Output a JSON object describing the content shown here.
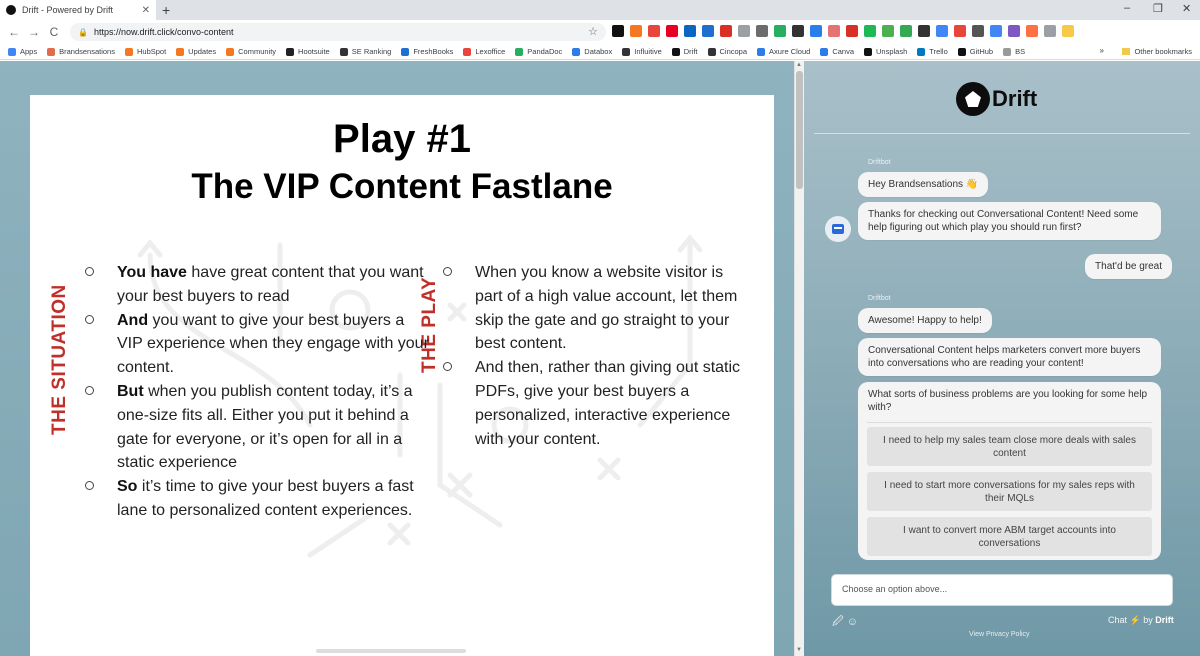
{
  "browser": {
    "tab_title": "Drift - Powered by Drift",
    "tab_close": "✕",
    "new_tab": "+",
    "url": "https://now.drift.click/convo-content",
    "win_min": "–",
    "win_max": "❐",
    "win_close": "✕",
    "back": "←",
    "forward": "→",
    "reload": "C",
    "star": "☆",
    "lock": "🔒"
  },
  "bookmarks": [
    {
      "label": "Apps",
      "color": "#4285f4"
    },
    {
      "label": "Brandsensations",
      "color": "#e06c4c"
    },
    {
      "label": "HubSpot",
      "color": "#f57722"
    },
    {
      "label": "Updates",
      "color": "#f57722"
    },
    {
      "label": "Community",
      "color": "#f57722"
    },
    {
      "label": "Hootsuite",
      "color": "#222"
    },
    {
      "label": "SE Ranking",
      "color": "#333"
    },
    {
      "label": "FreshBooks",
      "color": "#1f6fd1"
    },
    {
      "label": "Lexoffice",
      "color": "#e8453c"
    },
    {
      "label": "PandaDoc",
      "color": "#27ae60"
    },
    {
      "label": "Databox",
      "color": "#2b7de9"
    },
    {
      "label": "Influitive",
      "color": "#333"
    },
    {
      "label": "Drift",
      "color": "#111"
    },
    {
      "label": "Cincopa",
      "color": "#333"
    },
    {
      "label": "Axure Cloud",
      "color": "#2b7de9"
    },
    {
      "label": "Canva",
      "color": "#2b7de9"
    },
    {
      "label": "Unsplash",
      "color": "#111"
    },
    {
      "label": "Trello",
      "color": "#0079bf"
    },
    {
      "label": "GitHub",
      "color": "#111"
    },
    {
      "label": "BS",
      "color": "#999"
    }
  ],
  "bookmarks_more": "»",
  "bookmarks_other": "Other bookmarks",
  "extensions": [
    "#111",
    "#f57722",
    "#e8453c",
    "#e60023",
    "#0a66c2",
    "#1f6fd1",
    "#d93025",
    "#9aa0a6",
    "#6c6c6c",
    "#27ae60",
    "#333",
    "#2b7de9",
    "#e57373",
    "#d93025",
    "#1db954",
    "#4caf50",
    "#34a853",
    "#333",
    "#4285f4",
    "#e8453c",
    "#555",
    "#4285f4",
    "#7e57c2",
    "#ff7043",
    "#9aa0a6",
    "#f7c948"
  ],
  "doc": {
    "play_number": "Play #1",
    "play_name": "The VIP Content Fastlane",
    "situation_label": "THE SITUATION",
    "play_label": "THE PLAY",
    "situation": [
      {
        "bold": "You have",
        "text": " have great content that you want your best buyers to read"
      },
      {
        "bold": "And",
        "text": " you want to give your best buyers a VIP experience when they engage with your content."
      },
      {
        "bold": "But",
        "text": " when you publish content today, it’s a one-size fits all. Either you put it behind a gate for everyone, or it’s open for all in a static experience"
      },
      {
        "bold": "So",
        "text": " it’s time to give your best buyers a fast lane to personalized content experiences."
      }
    ],
    "play": [
      {
        "bold": "",
        "text": "When you know a website visitor is part of a high value account, let them skip the gate and go straight to your best content."
      },
      {
        "bold": "",
        "text": "And then, rather than giving out static PDFs, give your best buyers a personalized, interactive experience with your content."
      }
    ]
  },
  "chat": {
    "brand": "Drift",
    "sender": "Driftbot",
    "msg1": "Hey Brandsensations 👋",
    "msg2": "Thanks for checking out Conversational Content! Need some help figuring out which play you should run first?",
    "reply": "That'd be great",
    "msg3": "Awesome! Happy to help!",
    "msg4": "Conversational Content helps marketers convert more buyers into conversations who are reading your content!",
    "question": "What sorts of business problems are you looking for some help with?",
    "options": [
      "I need to help my sales team close more deals with sales content",
      "I need to start more conversations for my sales reps with their MQLs",
      "I want to convert more ABM target accounts into conversations"
    ],
    "compose_placeholder": "Choose an option above...",
    "tools": "🖉 ☺",
    "chat_by_prefix": "Chat",
    "chat_by_bolt": "⚡",
    "chat_by_mid": " by ",
    "chat_by_brand": "Drift",
    "privacy": "View Privacy Policy"
  }
}
